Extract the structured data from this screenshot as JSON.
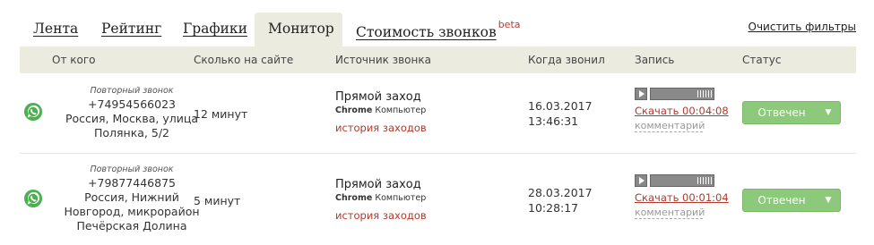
{
  "tabs": [
    {
      "label": "Лента"
    },
    {
      "label": "Рейтинг"
    },
    {
      "label": "Графики"
    },
    {
      "label": "Монитор"
    },
    {
      "label": "Стоимость звонков",
      "badge": "beta"
    }
  ],
  "clear_filters": "Очистить фильтры",
  "columns": {
    "from": "От кого",
    "time_on_site": "Сколько на сайте",
    "source": "Источник звонка",
    "when": "Когда звонил",
    "record": "Запись",
    "status": "Статус"
  },
  "rows": [
    {
      "repeat_label": "Повторный звонок",
      "phone": "+74954566023",
      "location": "Россия, Москва, улица Полянка, 5/2",
      "duration": "12 минут",
      "source_title": "Прямой заход",
      "browser": "Chrome",
      "device": "Компьютер",
      "history_label": "история заходов",
      "date": "16.03.2017",
      "time": "13:46:31",
      "download_label": "Скачать 00:04:08",
      "comment_label": "комментарий",
      "status_label": "Отвечен"
    },
    {
      "repeat_label": "Повторный звонок",
      "phone": "+79877446875",
      "location": "Россия, Нижний Новгород, микрорайон Печёрская Долина",
      "duration": "5 минут",
      "source_title": "Прямой заход",
      "browser": "Chrome",
      "device": "Компьютер",
      "history_label": "история заходов",
      "date": "28.03.2017",
      "time": "10:28:17",
      "download_label": "Скачать 00:01:04",
      "comment_label": "комментарий",
      "status_label": "Отвечен"
    }
  ],
  "icons": {
    "channel": "whatsapp-icon",
    "play": "play-icon",
    "volume": "volume-icon",
    "dropdown": "caret-down-icon"
  },
  "colors": {
    "accent_green": "#8cc97a",
    "link_red": "#b03a2e",
    "header_bg": "#ebebdf",
    "whatsapp": "#4caf50"
  }
}
